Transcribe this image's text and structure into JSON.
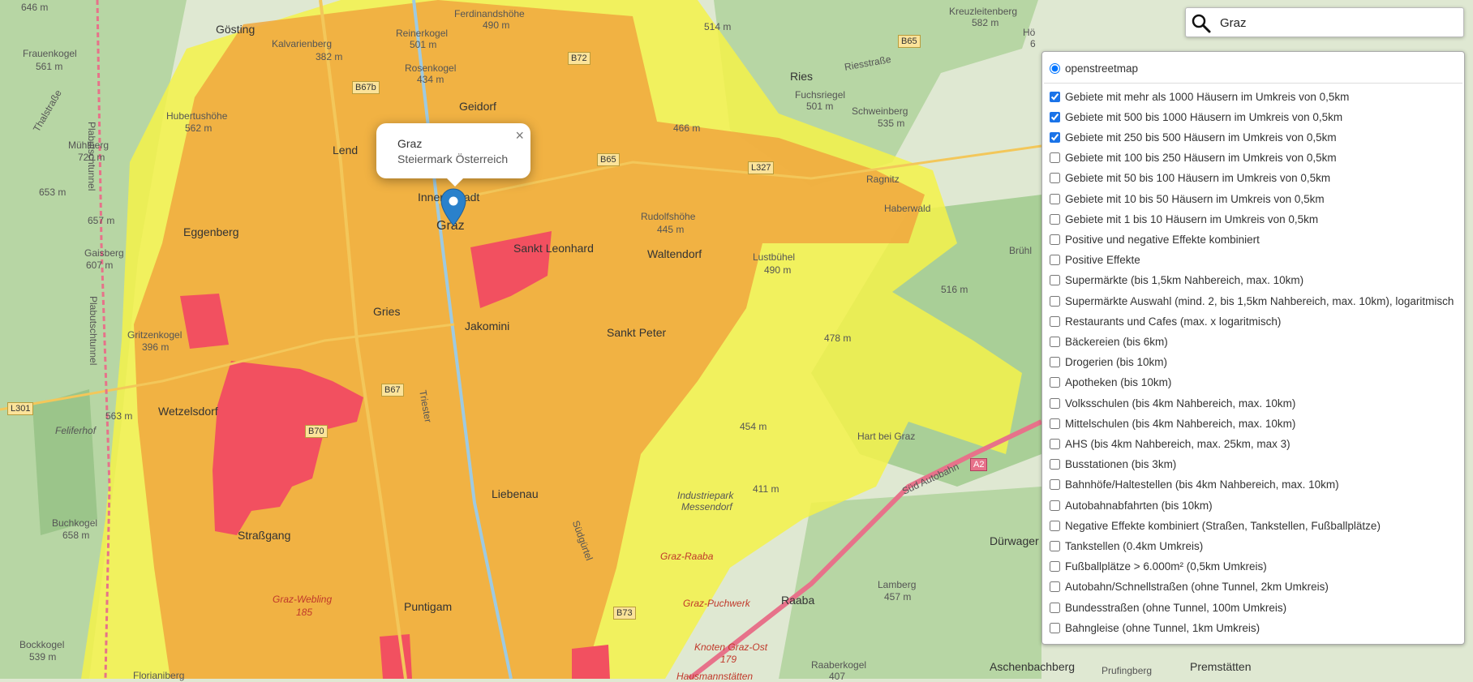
{
  "search": {
    "value": "Graz"
  },
  "popup": {
    "title": "Graz",
    "subtitle": "Steiermark Österreich",
    "close": "×"
  },
  "layers": {
    "base": "openstreetmap",
    "overlays": [
      {
        "label": "Gebiete mit mehr als 1000 Häusern im Umkreis von 0,5km",
        "checked": true
      },
      {
        "label": "Gebiete mit 500 bis 1000 Häusern im Umkreis von 0,5km",
        "checked": true
      },
      {
        "label": "Gebiete mit 250 bis 500 Häusern im Umkreis von 0,5km",
        "checked": true
      },
      {
        "label": "Gebiete mit 100 bis 250 Häusern im Umkreis von 0,5km",
        "checked": false
      },
      {
        "label": "Gebiete mit 50 bis 100 Häusern im Umkreis von 0,5km",
        "checked": false
      },
      {
        "label": "Gebiete mit 10 bis 50 Häusern im Umkreis von 0,5km",
        "checked": false
      },
      {
        "label": "Gebiete mit 1 bis 10 Häusern im Umkreis von 0,5km",
        "checked": false
      },
      {
        "label": "Positive und negative Effekte kombiniert",
        "checked": false
      },
      {
        "label": "Positive Effekte",
        "checked": false
      },
      {
        "label": "Supermärkte (bis 1,5km Nahbereich, max. 10km)",
        "checked": false
      },
      {
        "label": "Supermärkte Auswahl (mind. 2, bis 1,5km Nahbereich, max. 10km), logaritmisch",
        "checked": false
      },
      {
        "label": "Restaurants und Cafes (max. x logaritmisch)",
        "checked": false
      },
      {
        "label": "Bäckereien (bis 6km)",
        "checked": false
      },
      {
        "label": "Drogerien (bis 10km)",
        "checked": false
      },
      {
        "label": "Apotheken (bis 10km)",
        "checked": false
      },
      {
        "label": "Volksschulen (bis 4km Nahbereich, max. 10km)",
        "checked": false
      },
      {
        "label": "Mittelschulen (bis 4km Nahbereich, max. 10km)",
        "checked": false
      },
      {
        "label": "AHS (bis 4km Nahbereich, max. 25km, max 3)",
        "checked": false
      },
      {
        "label": "Busstationen (bis 3km)",
        "checked": false
      },
      {
        "label": "Bahnhöfe/Haltestellen (bis 4km Nahbereich, max. 10km)",
        "checked": false
      },
      {
        "label": "Autobahnabfahrten (bis 10km)",
        "checked": false
      },
      {
        "label": "Negative Effekte kombiniert (Straßen, Tankstellen, Fußballplätze)",
        "checked": false
      },
      {
        "label": "Tankstellen (0.4km Umkreis)",
        "checked": false
      },
      {
        "label": "Fußballplätze > 6.000m² (0,5km Umkreis)",
        "checked": false
      },
      {
        "label": "Autobahn/Schnellstraßen (ohne Tunnel, 2km Umkreis)",
        "checked": false
      },
      {
        "label": "Bundesstraßen (ohne Tunnel, 100m Umkreis)",
        "checked": false
      },
      {
        "label": "Bahngleise (ohne Tunnel, 1km Umkreis)",
        "checked": false
      }
    ]
  },
  "map": {
    "labels": {
      "goesting": "Gösting",
      "kalvarienberg": "Kalvarienberg",
      "kalvarienberg_h": "382 m",
      "reinerkogel": "Reinerkogel",
      "reinerkogel_h": "501 m",
      "rosenkogel": "Rosenkogel",
      "rosenkogel_h": "434 m",
      "ferdinandshoehe": "Ferdinandshöhe",
      "ferdinandshoehe_h": "490 m",
      "geidorf": "Geidorf",
      "lend": "Lend",
      "innere_stadt": "Innere Stadt",
      "graz": "Graz",
      "sankt_leonhard": "Sankt Leonhard",
      "waltendorf": "Waltendorf",
      "rudolfshoehe": "Rudolfshöhe",
      "rudolfshoehe_h": "445 m",
      "lustbuehel": "Lustbühel",
      "lustbuehel_h": "490 m",
      "ries": "Ries",
      "fuchsriegel": "Fuchsriegel",
      "fuchsriegel_h": "501 m",
      "schweinberg": "Schweinberg",
      "schweinberg_h": "535 m",
      "ragnitz": "Ragnitz",
      "haberwald": "Haberwald",
      "kreuzleitenberg": "Kreuzleitenberg",
      "kreuzleitenberg_h": "582 m",
      "hoe": "Hö",
      "hoe_h": "6",
      "bruehl": "Brühl",
      "h516": "516 m",
      "h478": "478 m",
      "h466": "466 m",
      "h514": "514 m",
      "h454": "454 m",
      "h411": "411 m",
      "frauenkogel": "Frauenkogel",
      "frauenkogel_h": "561 m",
      "hubertushoehe": "Hubertushöhe",
      "hubertushoehe_h": "562 m",
      "muehlberg": "Mühlberg",
      "muehlberg_h": "720 m",
      "h653": "653 m",
      "h657": "657 m",
      "h646": "646 m",
      "eggenberg": "Eggenberg",
      "gaisberg": "Gaisberg",
      "gaisberg_h": "607 m",
      "gritzenkogel": "Gritzenkogel",
      "gritzenkogel_h": "396 m",
      "gries": "Gries",
      "jakomini": "Jakomini",
      "sankt_peter": "Sankt Peter",
      "wetzelsdorf": "Wetzelsdorf",
      "feliferhof": "Feliferhof",
      "h563": "563 m",
      "hart_bei_graz": "Hart bei Graz",
      "liebenau": "Liebenau",
      "industriepark": "Industriepark",
      "messendorf": "Messendorf",
      "strassgang": "Straßgang",
      "buchkogel": "Buchkogel",
      "buchkogel_h": "658 m",
      "graz_raaba": "Graz-Raaba",
      "raaba": "Raaba",
      "graz_puchwerk": "Graz-Puchwerk",
      "graz_webling": "Graz-Webling",
      "graz_webling_km": "185",
      "puntigam": "Puntigam",
      "duerwager": "Dürwager",
      "lamberg": "Lamberg",
      "lamberg_h": "457 m",
      "knoten_graz_ost": "Knoten Graz-Ost",
      "knoten_km": "179",
      "hausmannstaetten": "Hausmannstätten",
      "bockkogel": "Bockkogel",
      "bockkogel_h": "539 m",
      "florianiberg": "Florianiberg",
      "aschenbachberg": "Aschenbachberg",
      "prufingberg": "Prufingberg",
      "premstaetten": "Premstätten",
      "raaberkogel": "Raaberkogel",
      "raaberkogel_h": "407",
      "plabutschtunnel_a": "Plabutschtunnel",
      "plabutschtunnel_b": "Plabutschtunnel",
      "thalstrasse": "Thalstraße",
      "sued_autobahn": "Süd Autobahn",
      "riesstrasse": "Riesstraße",
      "triester": "Triester",
      "suedgurtel": "Südgürtel"
    },
    "shields": {
      "b72": "B72",
      "b67b": "B67b",
      "b65a": "B65",
      "b65b": "B65",
      "l327": "L327",
      "b67": "B67",
      "b70": "B70",
      "b73": "B73",
      "l301": "L301",
      "a2": "A2"
    },
    "colors": {
      "base": "#dfe8d2",
      "forest": "#a9cf97",
      "yellow": "#f5f24a",
      "orange": "#f0a840",
      "red": "#f25060",
      "motorway": "#e7728a",
      "marker": "#2a81cb"
    }
  }
}
